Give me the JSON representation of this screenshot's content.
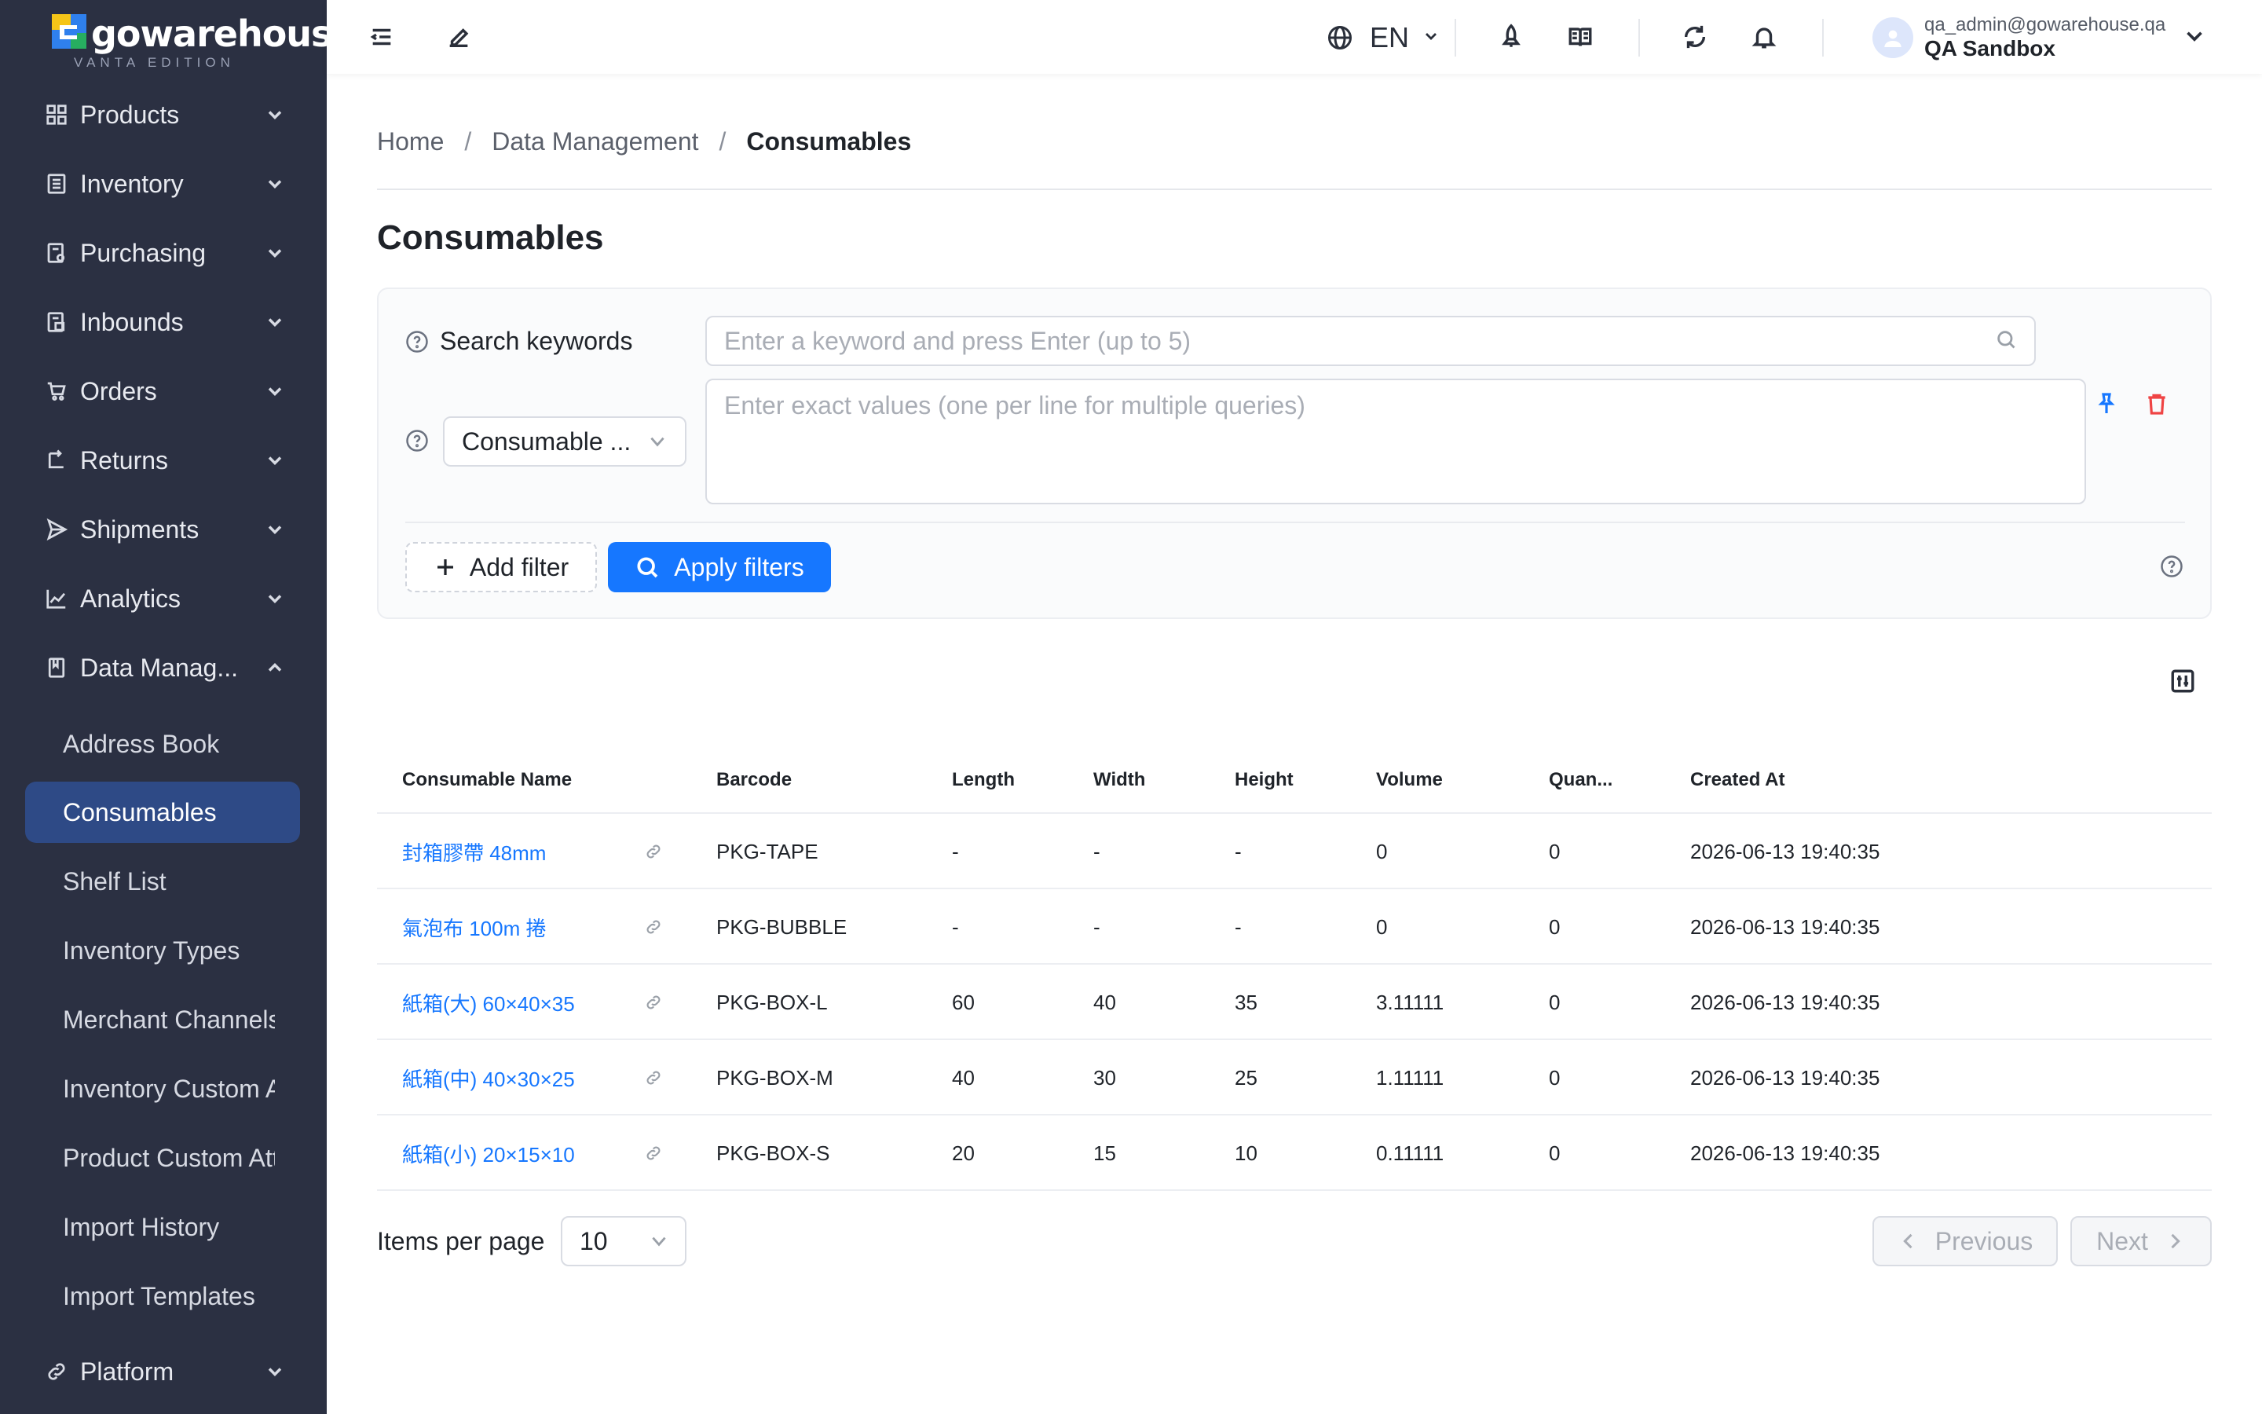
{
  "brand": {
    "name": "gowarehouse",
    "edition": "VANTA EDITION",
    "colors": {
      "mark_yellow": "#f5c518",
      "mark_blue": "#2f80ed",
      "mark_green": "#27ae60"
    }
  },
  "sidebar": {
    "items": [
      {
        "label": "Products",
        "icon": "grid-icon"
      },
      {
        "label": "Inventory",
        "icon": "list-icon"
      },
      {
        "label": "Purchasing",
        "icon": "purchase-doc-icon"
      },
      {
        "label": "Inbounds",
        "icon": "inbound-doc-icon"
      },
      {
        "label": "Orders",
        "icon": "cart-icon"
      },
      {
        "label": "Returns",
        "icon": "return-icon"
      },
      {
        "label": "Shipments",
        "icon": "send-icon"
      },
      {
        "label": "Analytics",
        "icon": "chart-icon"
      },
      {
        "label": "Data Manag...",
        "icon": "book-icon",
        "expanded": true
      },
      {
        "label": "Platform",
        "icon": "link-icon"
      }
    ],
    "data_management_children": [
      {
        "label": "Address Book",
        "active": false
      },
      {
        "label": "Consumables",
        "active": true
      },
      {
        "label": "Shelf List",
        "active": false
      },
      {
        "label": "Inventory Types",
        "active": false
      },
      {
        "label": "Merchant Channels",
        "active": false
      },
      {
        "label": "Inventory Custom Attributes",
        "active": false
      },
      {
        "label": "Product Custom Attributes",
        "active": false
      },
      {
        "label": "Import History",
        "active": false
      },
      {
        "label": "Import Templates",
        "active": false
      }
    ]
  },
  "topbar": {
    "language": "EN",
    "user_email": "qa_admin@gowarehouse.qa",
    "user_org": "QA Sandbox"
  },
  "breadcrumb": {
    "home": "Home",
    "parent": "Data Management",
    "current": "Consumables",
    "separator": "/"
  },
  "page": {
    "title": "Consumables"
  },
  "filters": {
    "search_label": "Search keywords",
    "search_placeholder": "Enter a keyword and press Enter (up to 5)",
    "field_select_value": "Consumable ...",
    "values_placeholder": "Enter exact values (one per line for multiple queries)",
    "add_filter_label": "Add filter",
    "apply_label": "Apply filters"
  },
  "table": {
    "columns": [
      "Consumable Name",
      "Barcode",
      "Length",
      "Width",
      "Height",
      "Volume",
      "Quan...",
      "Created At"
    ],
    "rows": [
      {
        "name": "封箱膠帶 48mm",
        "barcode": "PKG-TAPE",
        "length": "-",
        "width": "-",
        "height": "-",
        "volume": "0",
        "quantity": "0",
        "created_at": "2026-06-13 19:40:35"
      },
      {
        "name": "氣泡布 100m 捲",
        "barcode": "PKG-BUBBLE",
        "length": "-",
        "width": "-",
        "height": "-",
        "volume": "0",
        "quantity": "0",
        "created_at": "2026-06-13 19:40:35"
      },
      {
        "name": "紙箱(大) 60×40×35",
        "barcode": "PKG-BOX-L",
        "length": "60",
        "width": "40",
        "height": "35",
        "volume": "3.11111",
        "quantity": "0",
        "created_at": "2026-06-13 19:40:35"
      },
      {
        "name": "紙箱(中) 40×30×25",
        "barcode": "PKG-BOX-M",
        "length": "40",
        "width": "30",
        "height": "25",
        "volume": "1.11111",
        "quantity": "0",
        "created_at": "2026-06-13 19:40:35"
      },
      {
        "name": "紙箱(小) 20×15×10",
        "barcode": "PKG-BOX-S",
        "length": "20",
        "width": "15",
        "height": "10",
        "volume": "0.11111",
        "quantity": "0",
        "created_at": "2026-06-13 19:40:35"
      }
    ]
  },
  "pagination": {
    "items_per_page_label": "Items per page",
    "items_per_page_value": "10",
    "previous_label": "Previous",
    "next_label": "Next"
  }
}
